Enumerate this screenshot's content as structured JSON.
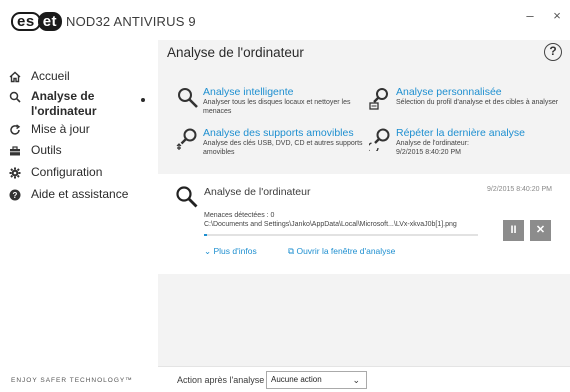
{
  "app": {
    "logo_left": "es",
    "logo_right": "et",
    "title": "NOD32 ANTIVIRUS 9",
    "minimize": "–",
    "close": "×"
  },
  "sidebar": {
    "items": [
      {
        "label": "Accueil",
        "icon": "home-icon"
      },
      {
        "label": "Analyse de l'ordinateur",
        "label_line1": "Analyse de",
        "label_line2": "l'ordinateur",
        "icon": "search-icon",
        "active": true
      },
      {
        "label": "Mise à jour",
        "icon": "refresh-icon"
      },
      {
        "label": "Outils",
        "icon": "briefcase-icon"
      },
      {
        "label": "Configuration",
        "icon": "gear-icon"
      },
      {
        "label": "Aide et assistance",
        "icon": "help-circle-icon"
      }
    ],
    "footer": "ENJOY SAFER TECHNOLOGY™"
  },
  "main": {
    "title": "Analyse de l'ordinateur",
    "help": "?",
    "options": [
      {
        "title": "Analyse intelligente",
        "desc": "Analyser tous les disques locaux et nettoyer les menaces"
      },
      {
        "title": "Analyse personnalisée",
        "desc": "Sélection du profil d'analyse et des cibles à analyser"
      },
      {
        "title": "Analyse des supports amovibles",
        "desc": "Analyse des clés USB, DVD, CD et autres supports amovibles"
      },
      {
        "title": "Répéter la dernière analyse",
        "desc": "Analyse de l'ordinateur:",
        "desc2": "9/2/2015 8:40:20 PM"
      }
    ],
    "scan": {
      "title": "Analyse de l'ordinateur",
      "date": "9/2/2015 8:40:20 PM",
      "threats": "Menaces détectées : 0",
      "path": "C:\\Documents and Settings\\Janko\\AppData\\Local\\Microsoft...\\LVx-xkvaJ0b[1].png",
      "progress": 0.01,
      "more_info": "Plus d'infos",
      "open_window": "Ouvrir la fenêtre d'analyse",
      "pause": "II",
      "stop": "✕"
    }
  },
  "bottom": {
    "after_label": "Action après l'analyse",
    "after_value": "Aucune action"
  },
  "colors": {
    "accent": "#1e8fd0",
    "main_bg": "#f3f3f3",
    "button_gray": "#8c8c8c"
  }
}
